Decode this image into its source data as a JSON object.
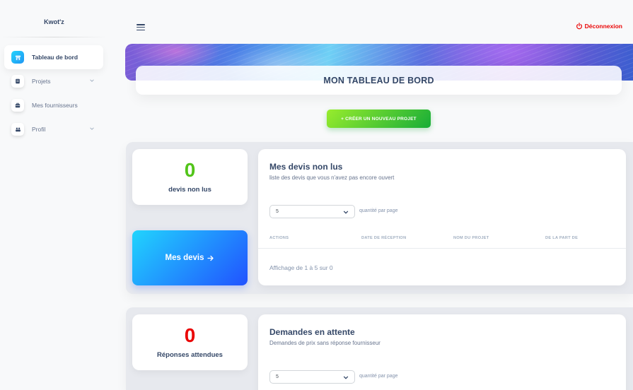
{
  "app": {
    "brand": "Kwot'z"
  },
  "sidebar": {
    "items": [
      {
        "label": "Tableau de bord",
        "icon": "shop-icon",
        "active": true,
        "has_chevron": false
      },
      {
        "label": "Projets",
        "icon": "document-icon",
        "active": false,
        "has_chevron": true
      },
      {
        "label": "Mes fournisseurs",
        "icon": "box-icon",
        "active": false,
        "has_chevron": false
      },
      {
        "label": "Profil",
        "icon": "users-icon",
        "active": false,
        "has_chevron": true
      }
    ]
  },
  "header": {
    "logout_label": "Déconnexion",
    "logout_color": "#ea0606"
  },
  "main": {
    "page_title": "MON TABLEAU DE BORD",
    "create_button_label": "+ CRÉER UN NOUVEAU PROJET",
    "unread_quotes": {
      "count": "0",
      "count_color": "#52c41a",
      "label": "devis non lus",
      "my_quotes_button": "Mes devis",
      "panel_title": "Mes devis non lus",
      "panel_subtitle": "liste des devis que vous n'avez pas encore ouvert",
      "per_page_value": "5",
      "per_page_label": "quantité par page",
      "columns": [
        "ACTIONS",
        "DATE DE RÉCEPTION",
        "NOM DU PROJET",
        "DE LA PART DE"
      ],
      "showing_text": "Affichage de 1 à 5 sur 0"
    },
    "pending_requests": {
      "count": "0",
      "count_color": "#ea0606",
      "label": "Réponses attendues",
      "panel_title": "Demandes en attente",
      "panel_subtitle": "Demandes de prix sans réponse fournisseur",
      "per_page_value": "5",
      "per_page_label": "quantité par page"
    }
  }
}
